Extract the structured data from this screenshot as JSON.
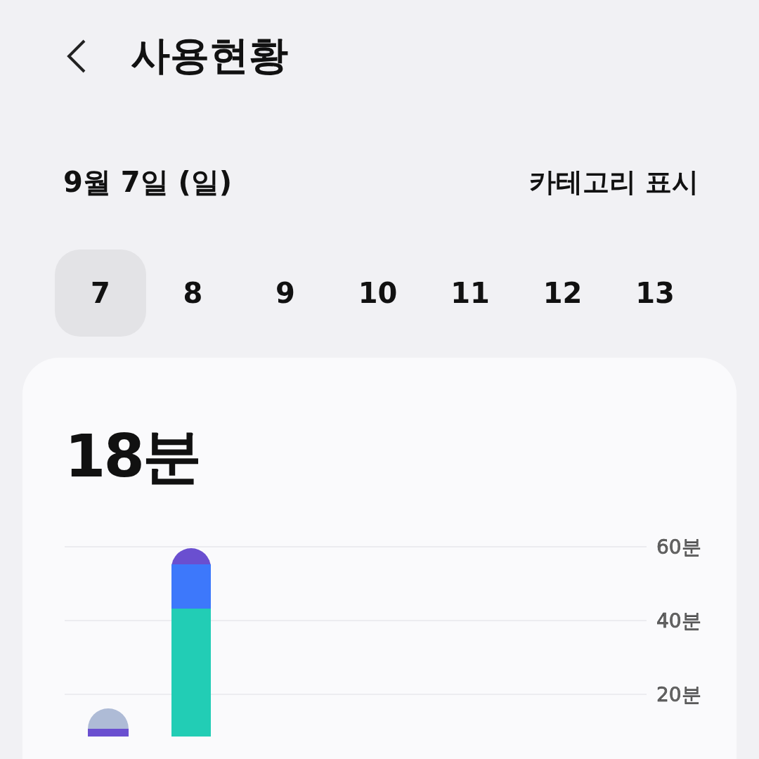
{
  "header": {
    "title": "사용현황"
  },
  "date_label": "9월 7일 (일)",
  "category_toggle": "카테고리 표시",
  "days": [
    {
      "label": "7",
      "selected": true
    },
    {
      "label": "8",
      "selected": false
    },
    {
      "label": "9",
      "selected": false
    },
    {
      "label": "10",
      "selected": false
    },
    {
      "label": "11",
      "selected": false
    },
    {
      "label": "12",
      "selected": false
    },
    {
      "label": "13",
      "selected": false
    }
  ],
  "usage_card": {
    "total": "18분",
    "axis_labels": [
      "60분",
      "40분",
      "20분"
    ]
  }
}
